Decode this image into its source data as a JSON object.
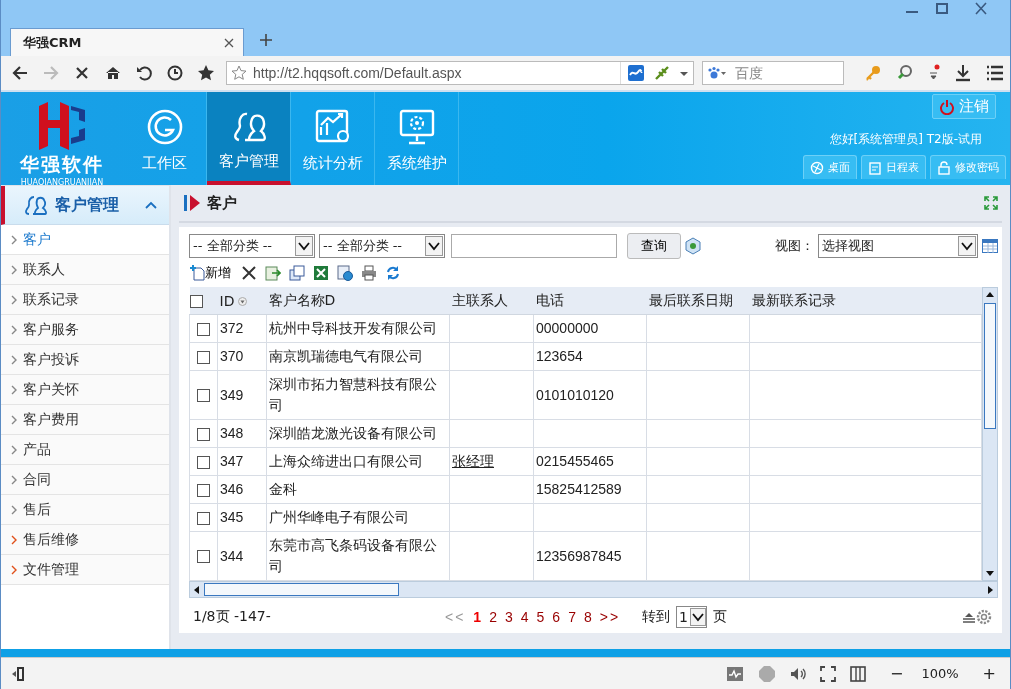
{
  "browser": {
    "tab": {
      "title": "华强CRM"
    },
    "address": "http://t2.hqqsoft.com/Default.aspx",
    "search": {
      "placeholder": "百度"
    }
  },
  "header": {
    "logo": {
      "name": "华强软件",
      "subtitle": "HUAQIANGRUANJIAN"
    },
    "nav": [
      {
        "label": "工作区",
        "selected": false
      },
      {
        "label": "客户管理",
        "selected": true
      },
      {
        "label": "统计分析",
        "selected": false
      },
      {
        "label": "系统维护",
        "selected": false
      }
    ],
    "logout": "注销",
    "greeting": "您好[系统管理员] T2版-试用",
    "quick_buttons": [
      "桌面",
      "日程表",
      "修改密码"
    ]
  },
  "sidebar": {
    "title": "客户管理",
    "items": [
      {
        "label": "客户",
        "selected": true,
        "expandable": false
      },
      {
        "label": "联系人",
        "selected": false,
        "expandable": false
      },
      {
        "label": "联系记录",
        "selected": false,
        "expandable": false
      },
      {
        "label": "客户服务",
        "selected": false,
        "expandable": false
      },
      {
        "label": "客户投诉",
        "selected": false,
        "expandable": false
      },
      {
        "label": "客户关怀",
        "selected": false,
        "expandable": false
      },
      {
        "label": "客户费用",
        "selected": false,
        "expandable": false
      },
      {
        "label": "产品",
        "selected": false,
        "expandable": false
      },
      {
        "label": "合同",
        "selected": false,
        "expandable": false
      },
      {
        "label": "售后",
        "selected": false,
        "expandable": false
      },
      {
        "label": "售后维修",
        "selected": false,
        "expandable": true
      },
      {
        "label": "文件管理",
        "selected": false,
        "expandable": true
      }
    ]
  },
  "main": {
    "title": "客户",
    "filters": [
      {
        "value": "-- 全部分类 --"
      },
      {
        "value": "-- 全部分类 --"
      }
    ],
    "query_button": "查询",
    "view_label": "视图：",
    "view_select": "选择视图",
    "new_button": "新增",
    "table": {
      "select_all_checked": false,
      "columns": [
        "ID",
        "客户名称D",
        "主联系人",
        "电话",
        "最后联系日期",
        "最新联系记录"
      ],
      "rows": [
        {
          "checked": false,
          "id": "372",
          "name": "杭州中导科技开发有限公司",
          "phone": "00000000"
        },
        {
          "checked": false,
          "id": "370",
          "name": "南京凯瑞德电气有限公司",
          "phone": "123654"
        },
        {
          "checked": false,
          "id": "349",
          "name": "深圳市拓力智慧科技有限公司",
          "phone": "0101010120"
        },
        {
          "checked": false,
          "id": "348",
          "name": "深圳皓龙激光设备有限公司"
        },
        {
          "checked": false,
          "id": "347",
          "name": "上海众缔进出口有限公司",
          "contact": "张经理",
          "phone": "0215455465"
        },
        {
          "checked": false,
          "id": "346",
          "name": "金科",
          "phone": "15825412589"
        },
        {
          "checked": false,
          "id": "345",
          "name": "广州华峰电子有限公司"
        },
        {
          "checked": false,
          "id": "344",
          "name": "东莞市高飞条码设备有限公司",
          "phone": "12356987845"
        }
      ]
    },
    "pager": {
      "summary": "1/8页 -147-",
      "first": "<<",
      "pages": [
        {
          "label": "1",
          "selected": true
        },
        {
          "label": "2",
          "selected": false
        },
        {
          "label": "3",
          "selected": false
        },
        {
          "label": "4",
          "selected": false
        },
        {
          "label": "5",
          "selected": false
        },
        {
          "label": "6",
          "selected": false
        },
        {
          "label": "7",
          "selected": false
        },
        {
          "label": "8",
          "selected": false
        }
      ],
      "last": ">>",
      "goto_label": "转到",
      "goto_value": "1",
      "goto_suffix": "页"
    }
  },
  "status_bar": {
    "zoom": "100%",
    "zoom_out": "−",
    "zoom_in": "+"
  }
}
